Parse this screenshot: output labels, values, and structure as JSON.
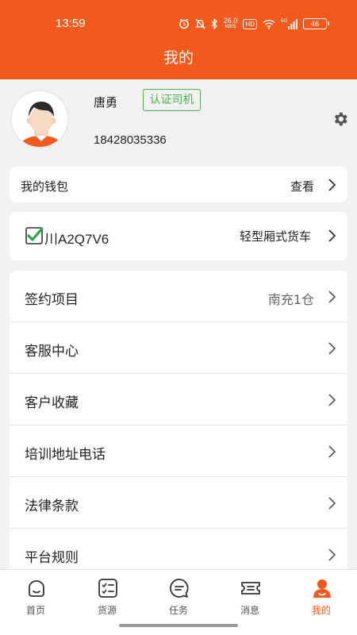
{
  "status_bar": {
    "time": "13:59",
    "net_speed": "26.0",
    "net_unit": "KB/S",
    "hd": "HD",
    "signal_tag": "5G",
    "battery": "46"
  },
  "header": {
    "title": "我的"
  },
  "profile": {
    "name": "唐勇",
    "badge": "认证司机",
    "phone": "18428035336"
  },
  "wallet": {
    "label": "我的钱包",
    "action": "查看"
  },
  "vehicle": {
    "plate": "川A2Q7V6",
    "type": "轻型厢式货车"
  },
  "menu": {
    "items": [
      {
        "label": "签约项目",
        "value": "南充1仓"
      },
      {
        "label": "客服中心",
        "value": ""
      },
      {
        "label": "客户收藏",
        "value": ""
      },
      {
        "label": "培训地址电话",
        "value": ""
      },
      {
        "label": "法律条款",
        "value": ""
      },
      {
        "label": "平台规则",
        "value": ""
      }
    ]
  },
  "tabbar": {
    "items": [
      {
        "label": "首页",
        "icon": "home-icon"
      },
      {
        "label": "货源",
        "icon": "cargo-list-icon"
      },
      {
        "label": "任务",
        "icon": "task-chat-icon"
      },
      {
        "label": "消息",
        "icon": "ticket-message-icon"
      },
      {
        "label": "我的",
        "icon": "user-icon"
      }
    ],
    "active_index": 4
  },
  "colors": {
    "brand": "#f25a1d",
    "verified_green": "#4caf50",
    "background": "#f2f2f2"
  }
}
